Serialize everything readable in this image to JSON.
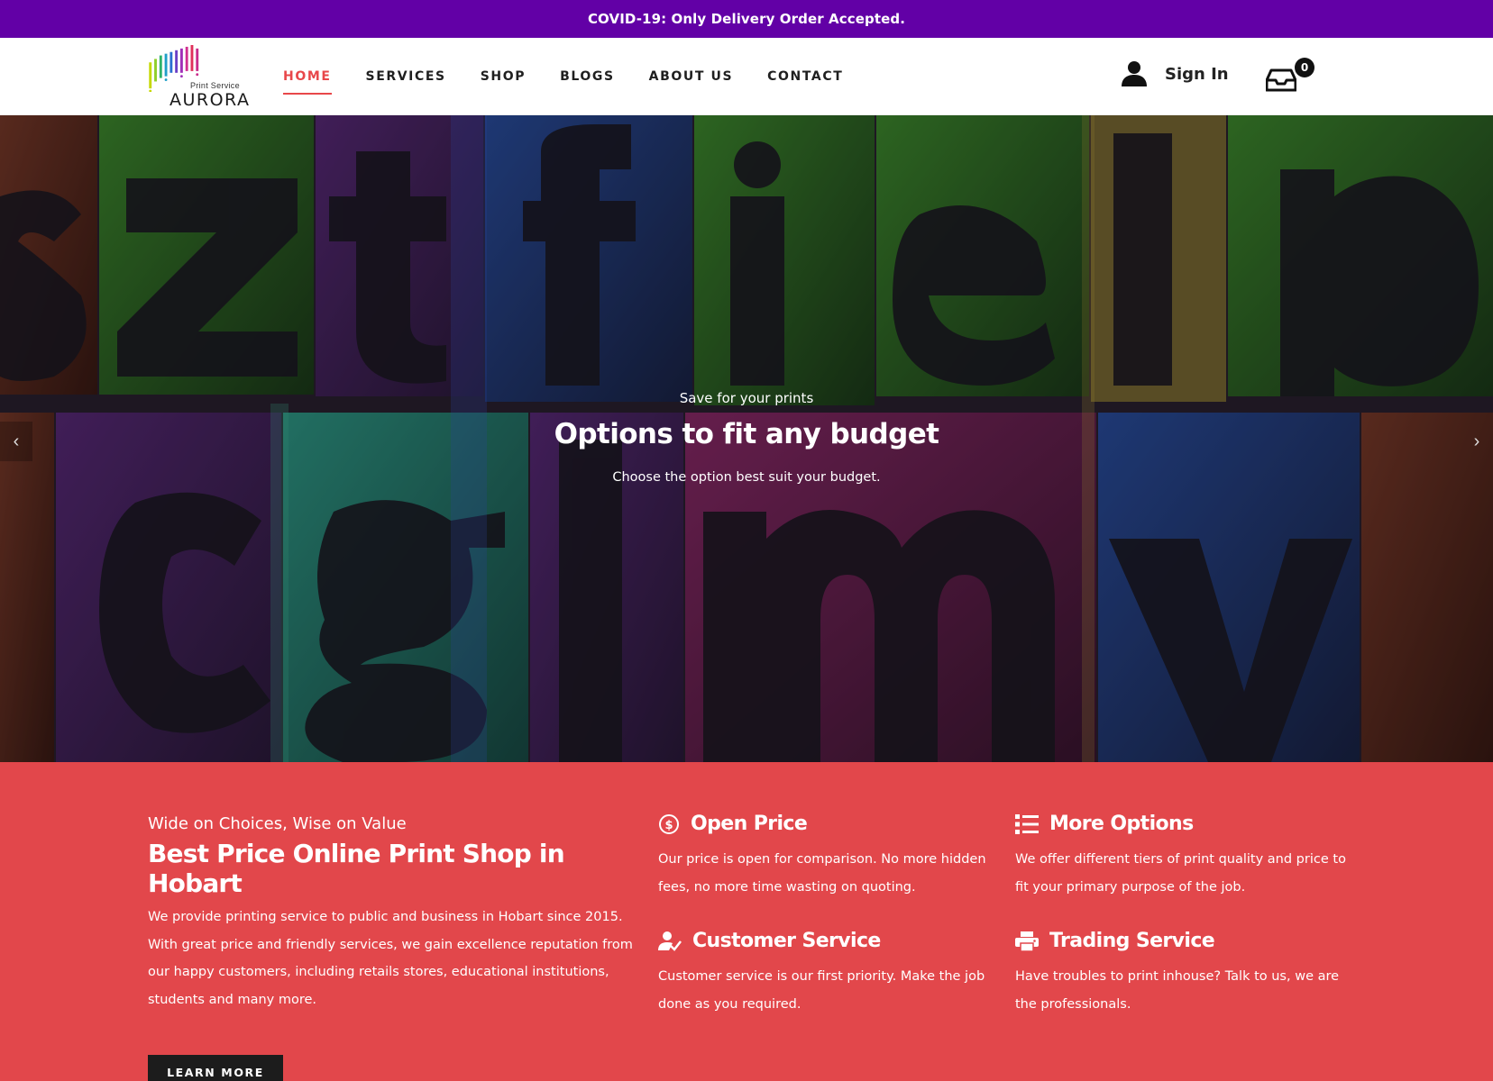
{
  "notice": {
    "text": "COVID-19: Only Delivery Order Accepted."
  },
  "logo": {
    "title": "AURORA",
    "subtitle": "Print Service"
  },
  "nav": {
    "items": [
      {
        "label": "HOME",
        "active": true
      },
      {
        "label": "SERVICES"
      },
      {
        "label": "SHOP"
      },
      {
        "label": "BLOGS"
      },
      {
        "label": "ABOUT US"
      },
      {
        "label": "CONTACT"
      }
    ]
  },
  "account": {
    "signin_label": "Sign In",
    "cart_count": "0"
  },
  "hero": {
    "kicker": "Save for your prints",
    "title": "Options to fit any budget",
    "subtitle": "Choose the option best suit your budget.",
    "prev_icon": "chevron-left-icon",
    "next_icon": "chevron-right-icon"
  },
  "features": {
    "intro": {
      "kicker": "Wide on Choices, Wise on Value",
      "title": "Best Price Online Print Shop in Hobart",
      "description": "We provide printing service to public and business in Hobart since 2015. With great price and friendly services, we gain excellence reputation from our happy customers, including retails stores, educational institutions, students and many more.",
      "button_label": "LEARN MORE"
    },
    "items": [
      {
        "icon": "dollar-circle-icon",
        "title": "Open Price",
        "description": "Our price is open for comparison. No more hidden fees, no more time wasting on quoting."
      },
      {
        "icon": "list-icon",
        "title": "More Options",
        "description": "We offer different tiers of print quality and price to fit your primary purpose of the job."
      },
      {
        "icon": "user-check-icon",
        "title": "Customer Service",
        "description": "Customer service is our first priority. Make the job done as you required."
      },
      {
        "icon": "printer-icon",
        "title": "Trading Service",
        "description": "Have troubles to print inhouse? Talk to us, we are the professionals."
      }
    ]
  },
  "colors": {
    "notice_bg": "#6200a6",
    "accent": "#e8474a",
    "features_bg": "#e2474b",
    "button_bg": "#1c1c1c"
  }
}
